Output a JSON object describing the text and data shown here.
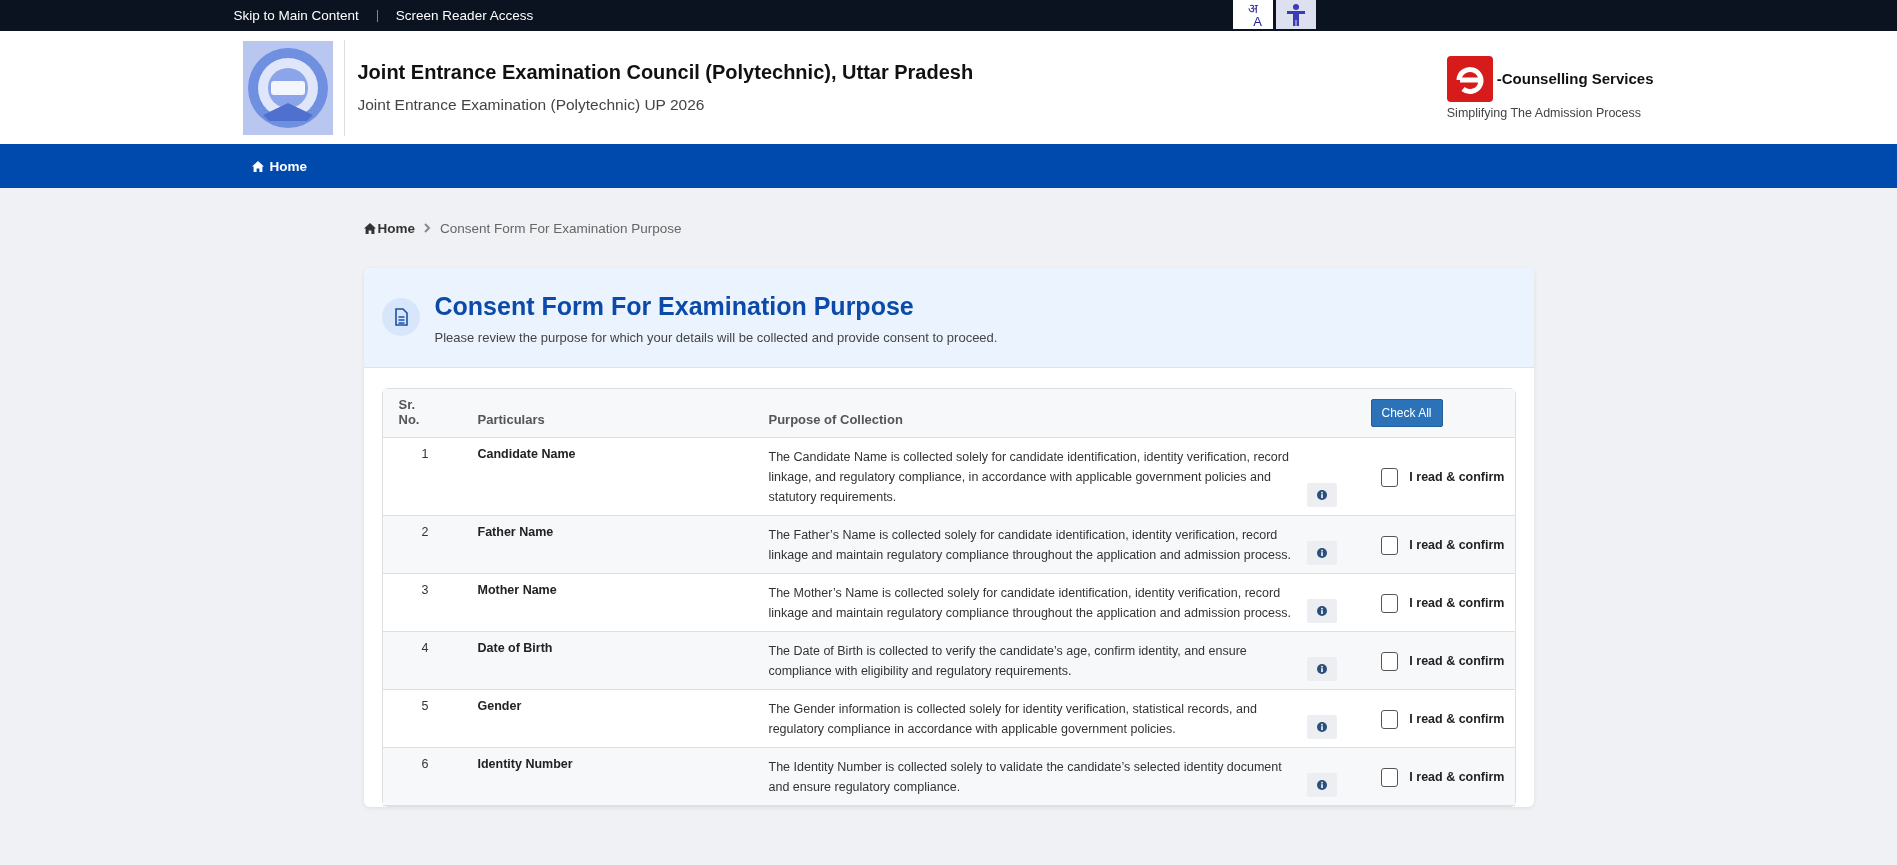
{
  "top_bar": {
    "links": [
      "Skip to Main Content",
      "Screen Reader Access"
    ],
    "language_button": {
      "top": "अ",
      "bottom": "A"
    }
  },
  "header": {
    "title": "Joint Entrance Examination Council (Polytechnic), Uttar Pradesh",
    "subtitle": "Joint Entrance Examination (Polytechnic) UP 2026",
    "brand": "-Counselling Services",
    "tagline": "Simplifying The Admission Process"
  },
  "nav": {
    "items": [
      "Home"
    ]
  },
  "breadcrumb": {
    "home": "Home",
    "current": "Consent Form For Examination Purpose"
  },
  "card": {
    "title": "Consent Form For Examination Purpose",
    "description": "Please review the purpose for which your details will be collected and provide consent to proceed."
  },
  "table": {
    "columns": [
      "Sr. No.",
      "Particulars",
      "Purpose of Collection"
    ],
    "check_all": "Check All",
    "rows": [
      {
        "sr": "1",
        "particular": "Candidate Name",
        "purpose": "The Candidate Name is collected solely for candidate identification, identity verification, record linkage, and regulatory compliance, in accordance with applicable government policies and statutory requirements.",
        "confirm": "I read & confirm",
        "checked": false
      },
      {
        "sr": "2",
        "particular": "Father Name",
        "purpose": "The Father’s Name is collected solely for candidate identification, identity verification, record linkage and maintain regulatory compliance throughout the application and admission process.",
        "confirm": "I read & confirm",
        "checked": false
      },
      {
        "sr": "3",
        "particular": "Mother Name",
        "purpose": "The Mother’s Name is collected solely for candidate identification, identity verification, record linkage and maintain regulatory compliance throughout the application and admission process.",
        "confirm": "I read & confirm",
        "checked": false
      },
      {
        "sr": "4",
        "particular": "Date of Birth",
        "purpose": "The Date of Birth is collected to verify the candidate’s age, confirm identity, and ensure compliance with eligibility and regulatory requirements.",
        "confirm": "I read & confirm",
        "checked": false
      },
      {
        "sr": "5",
        "particular": "Gender",
        "purpose": "The Gender information is collected solely for identity verification, statistical records, and regulatory compliance in accordance with applicable government policies.",
        "confirm": "I read & confirm",
        "checked": false
      },
      {
        "sr": "6",
        "particular": "Identity Number",
        "purpose": "The Identity Number is collected solely to validate the candidate’s selected identity document and ensure regulatory compliance.",
        "confirm": "I read & confirm",
        "checked": false
      }
    ]
  }
}
